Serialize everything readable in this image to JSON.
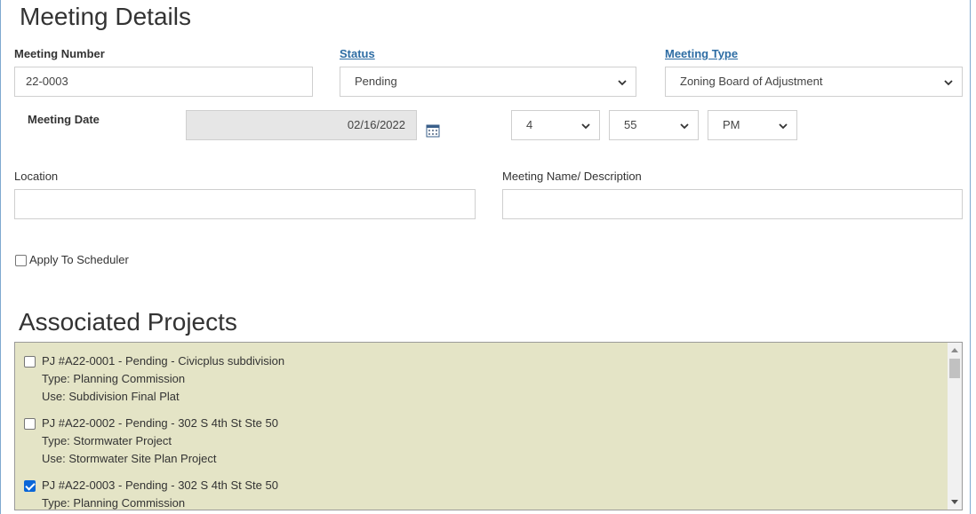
{
  "details": {
    "title": "Meeting Details",
    "meeting_number_label": "Meeting Number",
    "meeting_number_value": "22-0003",
    "status_label": "Status",
    "status_value": "Pending",
    "meeting_type_label": "Meeting Type",
    "meeting_type_value": "Zoning Board of Adjustment",
    "meeting_date_label": "Meeting Date",
    "meeting_date_value": "02/16/2022",
    "hour_value": "4",
    "minute_value": "55",
    "ampm_value": "PM",
    "location_label": "Location",
    "location_value": "",
    "meeting_name_label": "Meeting Name/ Description",
    "meeting_name_value": "",
    "apply_scheduler_label": "Apply To Scheduler",
    "apply_scheduler_checked": false
  },
  "projects": {
    "title": "Associated Projects",
    "items": [
      {
        "title": "PJ #A22-0001 - Pending - Civicplus subdivision",
        "type": "Type: Planning Commission",
        "use": "Use: Subdivision Final Plat",
        "checked": false
      },
      {
        "title": "PJ #A22-0002 - Pending - 302 S 4th St Ste 50",
        "type": "Type: Stormwater Project",
        "use": "Use: Stormwater Site Plan Project",
        "checked": false
      },
      {
        "title": "PJ #A22-0003 - Pending - 302 S 4th St Ste 50",
        "type": "Type: Planning Commission",
        "use": "",
        "checked": true
      }
    ]
  },
  "icons": {
    "calendar": "calendar-icon",
    "chevron": "chevron-down-icon"
  },
  "colors": {
    "link": "#2e6da4",
    "projects_bg": "#e4e4c6",
    "checkbox_checked": "#0a66d8",
    "disabled_bg": "#e6e6e6"
  }
}
